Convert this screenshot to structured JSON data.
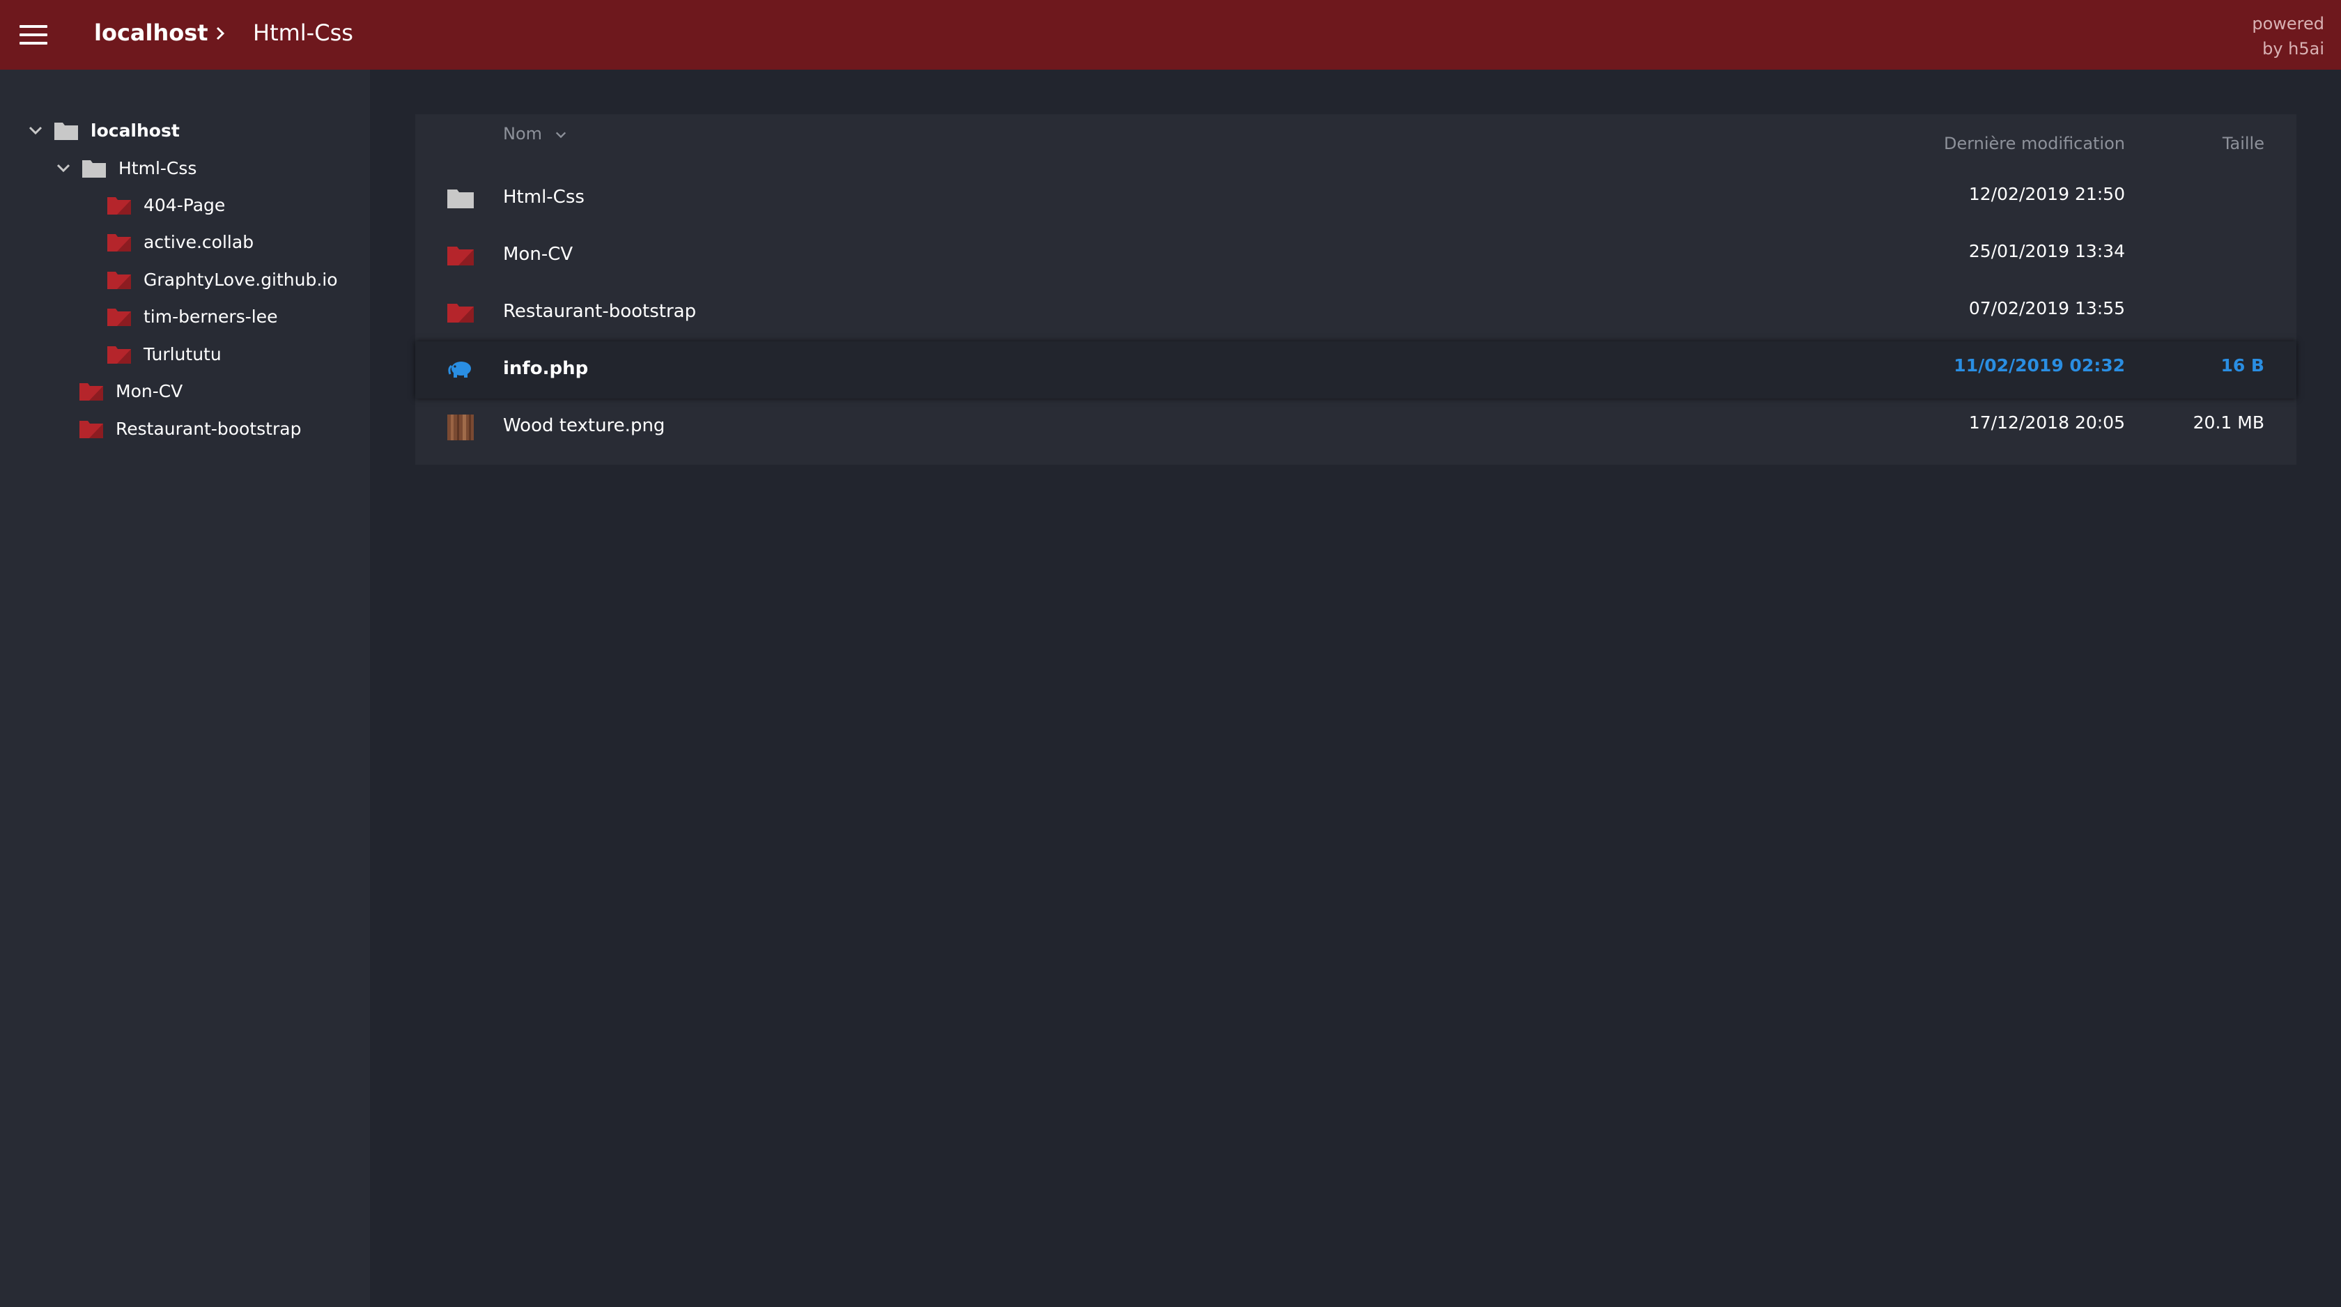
{
  "header": {
    "root": "localhost",
    "current": "Html-Css",
    "powered_line1": "powered",
    "powered_line2": "by h5ai",
    "background_color": "#6e181d"
  },
  "sidebar": {
    "items": [
      {
        "label": "localhost",
        "icon": "folder-gray-icon",
        "expanded": true
      },
      {
        "label": "Html-Css",
        "icon": "folder-gray-icon",
        "expanded": true
      },
      {
        "label": "404-Page",
        "icon": "folder-red-icon"
      },
      {
        "label": "active.collab",
        "icon": "folder-red-icon"
      },
      {
        "label": "GraphtyLove.github.io",
        "icon": "folder-red-icon"
      },
      {
        "label": "tim-berners-lee",
        "icon": "folder-red-icon"
      },
      {
        "label": "Turlututu",
        "icon": "folder-red-icon"
      },
      {
        "label": "Mon-CV",
        "icon": "folder-red-icon"
      },
      {
        "label": "Restaurant-bootstrap",
        "icon": "folder-red-icon"
      }
    ]
  },
  "table": {
    "col_name": "Nom",
    "col_modified": "Dernière modification",
    "col_size": "Taille",
    "rows": [
      {
        "name": "Html-Css",
        "modified": "12/02/2019 21:50",
        "size": "",
        "icon": "folder-gray-icon"
      },
      {
        "name": "Mon-CV",
        "modified": "25/01/2019 13:34",
        "size": "",
        "icon": "folder-red-icon"
      },
      {
        "name": "Restaurant-bootstrap",
        "modified": "07/02/2019 13:55",
        "size": "",
        "icon": "folder-red-icon"
      },
      {
        "name": "info.php",
        "modified": "11/02/2019 02:32",
        "size": "16 B",
        "icon": "php-elephant-icon",
        "active": true
      },
      {
        "name": "Wood texture.png",
        "modified": "17/12/2018 20:05",
        "size": "20.1 MB",
        "icon": "image-thumbnail-icon"
      }
    ]
  },
  "colors": {
    "accent": "#2a8ee2",
    "folder_red": "#b5252b",
    "folder_gray": "#c8c8c8",
    "sidebar_bg": "#282b34",
    "main_bg": "#22252e"
  }
}
